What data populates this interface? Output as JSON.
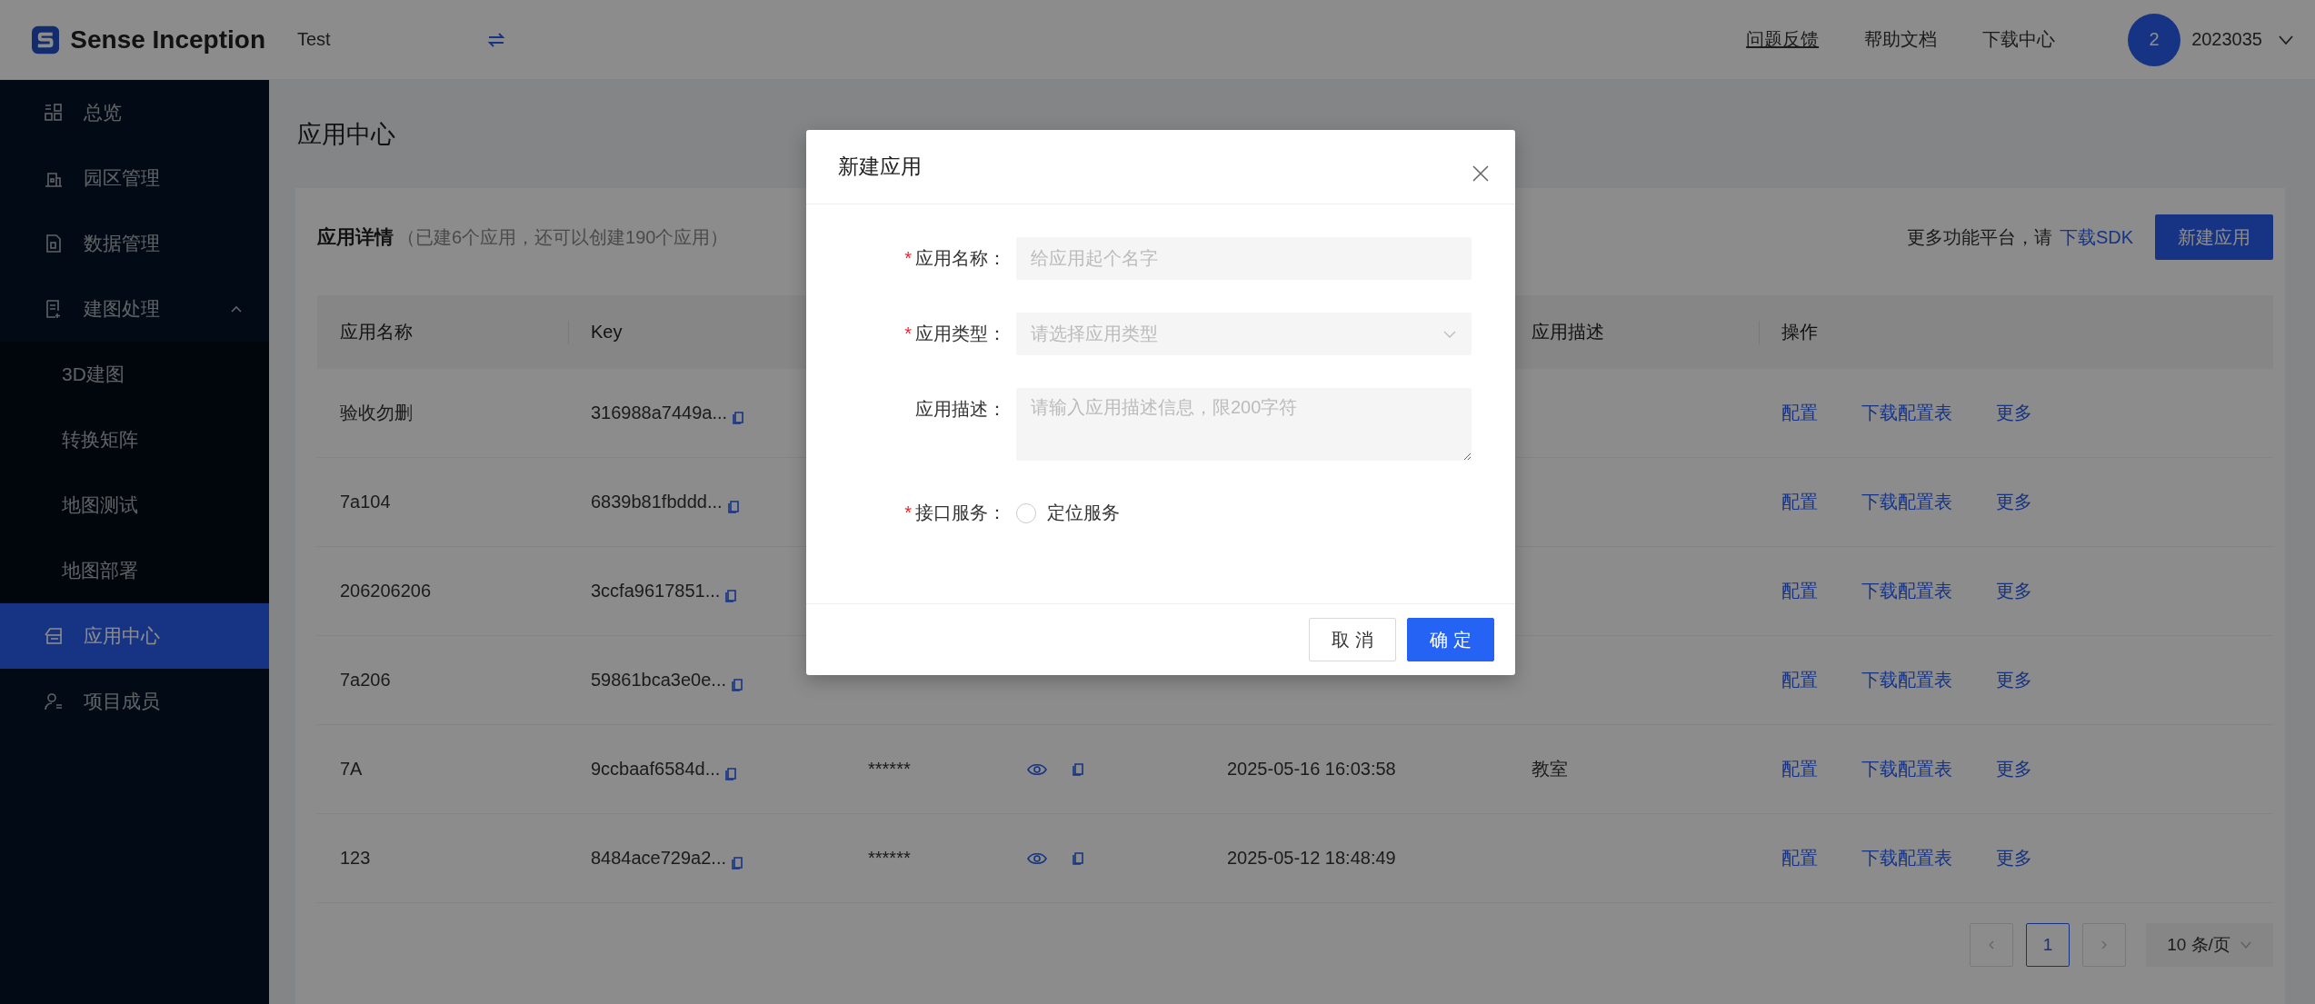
{
  "header": {
    "logo": "Sense Inception",
    "project": "Test",
    "links": [
      {
        "label": "问题反馈",
        "underlined": true
      },
      {
        "label": "帮助文档",
        "underlined": false
      },
      {
        "label": "下载中心",
        "underlined": false
      }
    ],
    "avatar": "2",
    "user": "2023035"
  },
  "sidebar": {
    "items": [
      {
        "label": "总览",
        "selected": false
      },
      {
        "label": "园区管理",
        "selected": false
      },
      {
        "label": "数据管理",
        "selected": false
      },
      {
        "label": "建图处理",
        "selected": false,
        "expanded": true,
        "children": [
          {
            "label": "3D建图",
            "selected": false
          },
          {
            "label": "转换矩阵",
            "selected": false
          },
          {
            "label": "地图测试",
            "selected": false
          },
          {
            "label": "地图部署",
            "selected": false
          }
        ]
      },
      {
        "label": "应用中心",
        "selected": true
      },
      {
        "label": "项目成员",
        "selected": false
      }
    ]
  },
  "page_title": "应用中心",
  "card": {
    "title": "应用详情",
    "note": "（已建6个应用，还可以创建190个应用）",
    "sdk_prompt": "更多功能平台，请",
    "sdk_link": "下载SDK",
    "new_button": "新建应用"
  },
  "table": {
    "columns": [
      "应用名称",
      "Key",
      null,
      null,
      null,
      "应用描述",
      "操作"
    ],
    "rows": [
      {
        "name": "验收勿删",
        "key": "316988a7449a...",
        "actions": [
          "配置",
          "下载配置表",
          "更多"
        ]
      },
      {
        "name": "7a104",
        "key": "6839b81fbddd...",
        "actions": [
          "配置",
          "下载配置表",
          "更多"
        ]
      },
      {
        "name": "206206206",
        "key": "3ccfa9617851...",
        "actions": [
          "配置",
          "下载配置表",
          "更多"
        ]
      },
      {
        "name": "7a206",
        "key": "59861bca3e0e...",
        "actions": [
          "配置",
          "下载配置表",
          "更多"
        ]
      },
      {
        "name": "7A",
        "key": "9ccbaaf6584d...",
        "secret": "******",
        "time": "2025-05-16 16:03:58",
        "description": "教室",
        "actions": [
          "配置",
          "下载配置表",
          "更多"
        ]
      },
      {
        "name": "123",
        "key": "8484ace729a2...",
        "secret": "******",
        "time": "2025-05-12 18:48:49",
        "actions": [
          "配置",
          "下载配置表",
          "更多"
        ]
      }
    ]
  },
  "pagination": {
    "pages": [
      {
        "label": "1",
        "selected": true
      }
    ],
    "page_size": "10 条/页"
  },
  "modal": {
    "title": "新建应用",
    "fields": [
      {
        "kind": "input",
        "mark": "*",
        "label": "应用名称：",
        "placeholder": "给应用起个名字"
      },
      {
        "kind": "select",
        "mark": "*",
        "label": "应用类型：",
        "placeholder": "请选择应用类型"
      },
      {
        "kind": "textarea",
        "label": "应用描述：",
        "placeholder": "请输入应用描述信息，限200字符"
      },
      {
        "kind": "radio",
        "mark": "*",
        "label": "接口服务：",
        "options": [
          {
            "label": "定位服务",
            "checked": false
          }
        ]
      }
    ],
    "buttons": [
      {
        "label": "取 消",
        "kind": "default"
      },
      {
        "label": "确 定",
        "kind": "primary"
      }
    ]
  }
}
